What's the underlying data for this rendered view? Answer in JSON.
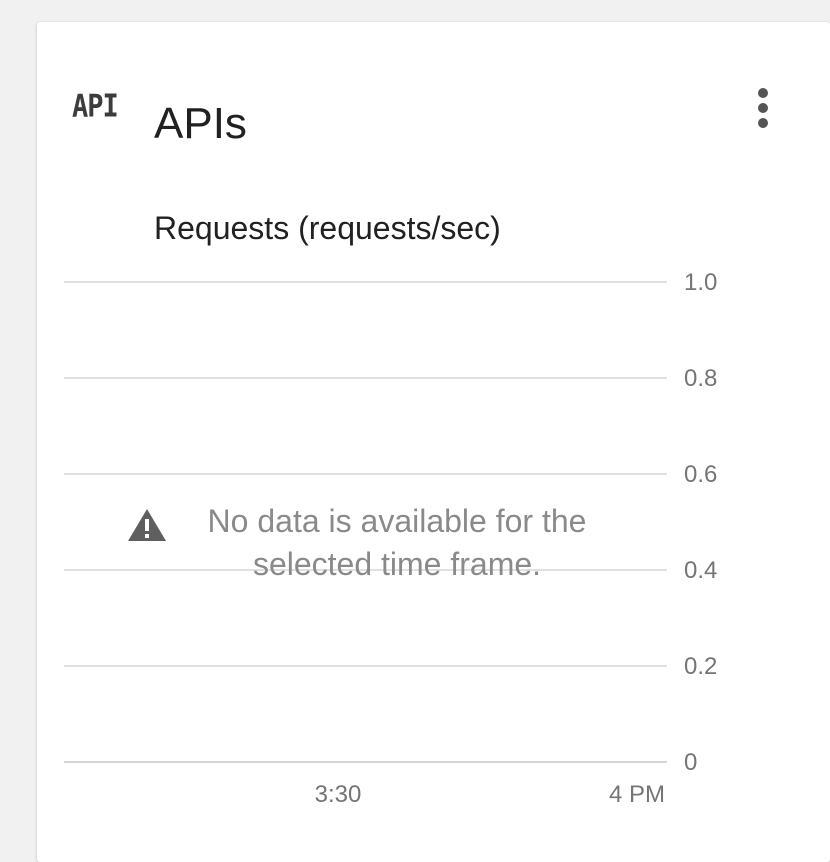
{
  "card": {
    "icon_text": "API",
    "title": "APIs",
    "menu_icon": "more-vert-icon"
  },
  "chart_data": {
    "type": "line",
    "title": "Requests (requests/sec)",
    "series": [],
    "x_ticks": [
      "3:30",
      "4 PM"
    ],
    "y_ticks": [
      1.0,
      0.8,
      0.6,
      0.4,
      0.2,
      0
    ],
    "y_tick_labels": [
      "1.0",
      "0.8",
      "0.6",
      "0.4",
      "0.2",
      "0"
    ],
    "ylim": [
      0,
      1.0
    ],
    "grid": true,
    "empty_message": "No data is available for the selected time frame.",
    "empty_icon": "warning-icon",
    "colors": {
      "grid": "#e0e0e0",
      "tick_label": "#757575",
      "message": "#8a8a8a"
    }
  }
}
